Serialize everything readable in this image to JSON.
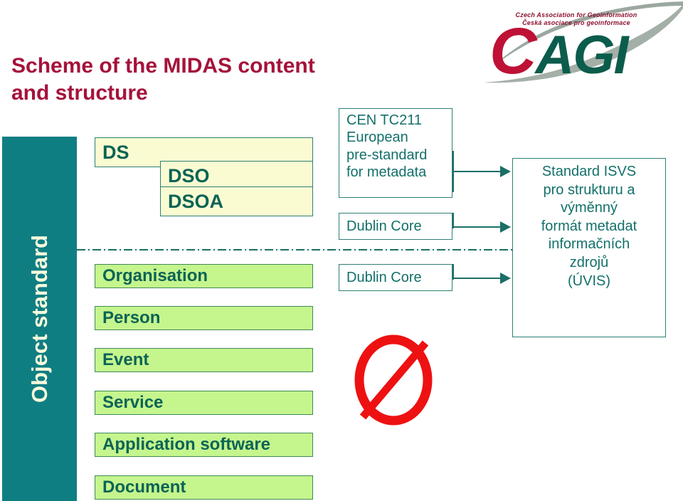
{
  "slide": {
    "title": "Scheme of the MIDAS content and structure",
    "title_line1": "Scheme of the MIDAS content",
    "title_line2": "and structure",
    "background_color": "#ffffff"
  },
  "logo": {
    "name": "cagi-logo",
    "wordmark_c": "C",
    "wordmark_agi": "AGI",
    "tagline_en": "Czech Association for Geoinformation",
    "tagline_cs": "Česká asociace pro geoinformace",
    "colors": {
      "c_red": "#BE1135",
      "agi_green": "#0B5C4C",
      "swoosh_gray": "#9BA8A0",
      "tagline_red": "#8C1230"
    }
  },
  "left_band": {
    "label": "Object standard",
    "background_color": "#0F7E83",
    "text_color": "#FBFBDC"
  },
  "object_column": {
    "dataset_boxes": [
      {
        "label": "DS",
        "color": "#FBFBD2"
      },
      {
        "label": "DSO",
        "color": "#FBFBD2"
      },
      {
        "label": "DSOA",
        "color": "#FBFBD2"
      }
    ],
    "entity_boxes": [
      {
        "label": "Organisation",
        "color": "#C5F58D"
      },
      {
        "label": "Person",
        "color": "#C5F58D"
      },
      {
        "label": "Event",
        "color": "#C5F58D"
      },
      {
        "label": "Service",
        "color": "#C5F58D"
      },
      {
        "label": "Application software",
        "color": "#C5F58D"
      },
      {
        "label": "Document",
        "color": "#C5F58D"
      }
    ]
  },
  "standard_column": {
    "boxes": [
      {
        "label": "CEN TC211 European pre-standard for metadata",
        "lines": [
          "CEN TC211",
          "European",
          "pre-standard",
          "for metadata"
        ]
      },
      {
        "label": "Dublin Core",
        "lines": [
          "Dublin Core"
        ]
      },
      {
        "label": "Dublin Core",
        "lines": [
          "Dublin Core"
        ]
      }
    ],
    "empty_set_symbol": "Ø",
    "empty_set_color": "#EE1111"
  },
  "target_column": {
    "box_label": "Standard ISVS pro strukturu a výměnný formát metadat informačních zdrojů (ÚVIS)",
    "lines": [
      "Standard ISVS",
      "pro strukturu a",
      "výměnný",
      "formát metadat",
      "informačních",
      "zdrojů",
      "(ÚVIS)"
    ]
  },
  "connectors": {
    "arrow_color": "#1A6F67",
    "divider_style": "dash-dot",
    "divider_color": "#1A6F67",
    "count": 3
  }
}
